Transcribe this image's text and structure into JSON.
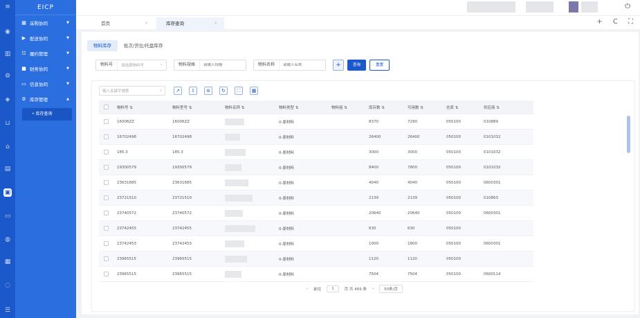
{
  "brand": "EICP",
  "colors": {
    "primary": "#1b58c9",
    "sidebar": "#2b6ee0"
  },
  "rail_icons": [
    "menu-icon",
    "circle-icon",
    "chart-icon",
    "gear-icon",
    "shield-icon",
    "cart-icon",
    "home-icon",
    "building-icon",
    "box-icon",
    "doc-icon",
    "bag-icon",
    "calendar-icon",
    "link-icon",
    "list-icon"
  ],
  "sidebar": {
    "items": [
      {
        "label": "采购协同",
        "icon": "table-icon"
      },
      {
        "label": "配送协同",
        "icon": "truck-icon"
      },
      {
        "label": "履约管理",
        "icon": "list-icon"
      },
      {
        "label": "财务协同",
        "icon": "finance-icon"
      },
      {
        "label": "信息协同",
        "icon": "info-icon"
      },
      {
        "label": "库存管理",
        "icon": "warehouse-icon"
      }
    ],
    "active_sub": "• 库存查询"
  },
  "tabs": [
    {
      "label": "首页",
      "close": "×"
    },
    {
      "label": "库存查询",
      "close": "×"
    }
  ],
  "tab_actions": "+ C ⛶",
  "subtabs": [
    "物料库存",
    "批次/货位/托盘库存"
  ],
  "filters": {
    "f1": {
      "label": "物料号",
      "placeholder": "请选择物料号"
    },
    "f2": {
      "label": "物料规格",
      "placeholder": "请输入规格"
    },
    "f3": {
      "label": "物料名称",
      "placeholder": "请输入名称"
    },
    "plus": "+",
    "query": "查询",
    "reset": "重置"
  },
  "toolbar": {
    "keyword_placeholder": "输入关键字搜索"
  },
  "table": {
    "headers": [
      "物料号 ⇅",
      "物料型号 ⇅",
      "物料名称 ⇅",
      "物料类型 ⇅",
      "物料组 ⇅",
      "库存数 ⇅",
      "可用数 ⇅",
      "仓库 ⇅",
      "供应商 ⇅"
    ],
    "rows": [
      {
        "no": "16006ZZ",
        "model": "16006ZZ",
        "type": "0-原材料",
        "stock": "8370",
        "avail": "7290",
        "wh": "050100",
        "sup": "010889"
      },
      {
        "no": "16702498",
        "model": "16702498",
        "type": "0-原材料",
        "stock": "26400",
        "avail": "26400",
        "wh": "050100",
        "sup": "0101032"
      },
      {
        "no": "185.3",
        "model": "185.3",
        "type": "0-原材料",
        "stock": "3000",
        "avail": "3000",
        "wh": "050100",
        "sup": "0101032"
      },
      {
        "no": "19300579",
        "model": "19300579",
        "type": "0-原材料",
        "stock": "8400",
        "avail": "7800",
        "wh": "050100",
        "sup": "0101032"
      },
      {
        "no": "23631685",
        "model": "23631685",
        "type": "0-原材料",
        "stock": "4040",
        "avail": "4040",
        "wh": "050100",
        "sup": "0600301"
      },
      {
        "no": "23721510",
        "model": "23721510",
        "type": "0-原材料",
        "stock": "2139",
        "avail": "2139",
        "wh": "050100",
        "sup": "010863"
      },
      {
        "no": "23740572",
        "model": "23740572",
        "type": "0-原材料",
        "stock": "20640",
        "avail": "20640",
        "wh": "050100",
        "sup": "0600301"
      },
      {
        "no": "23742455",
        "model": "23742455",
        "type": "0-原材料",
        "stock": "630",
        "avail": "630",
        "wh": "050100",
        "sup": ""
      },
      {
        "no": "23742453",
        "model": "23742453",
        "type": "0-原材料",
        "stock": "1000",
        "avail": "1800",
        "wh": "050100",
        "sup": "0600301"
      },
      {
        "no": "23965515",
        "model": "23965515",
        "type": "0-原材料",
        "stock": "1120",
        "avail": "1120",
        "wh": "050100",
        "sup": ""
      },
      {
        "no": "23965515",
        "model": "23965515",
        "type": "0-原材料",
        "stock": "7504",
        "avail": "7504",
        "wh": "050100",
        "sup": "0600114"
      }
    ]
  },
  "pager": {
    "prev": "‹",
    "goto": "前往",
    "page": "1",
    "total": "页 共 469 条",
    "next": "›",
    "size": "50条/页"
  }
}
